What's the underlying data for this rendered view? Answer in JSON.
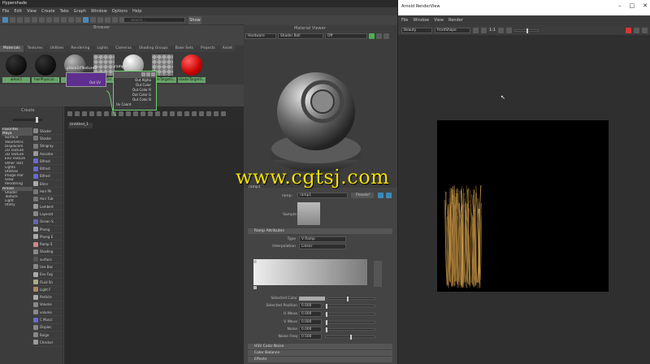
{
  "hypershade": {
    "title": "Hypershade",
    "menu": [
      "File",
      "Edit",
      "View",
      "Create",
      "Tabs",
      "Graph",
      "Window",
      "Options",
      "Help"
    ],
    "browser_label": "Browser",
    "search_placeholder": "Search...",
    "show_label": "Show",
    "tabs": [
      "Materials",
      "Textures",
      "Utilities",
      "Rendering",
      "Lights",
      "Cameras",
      "Shading Groups",
      "Bake Sets",
      "Projects",
      "Asset"
    ],
    "swatches": [
      {
        "label": "aiHair1",
        "color": "#111111",
        "type": "dark"
      },
      {
        "label": "hairPhysical...",
        "color": "#151515",
        "type": "dark"
      },
      {
        "label": "lambert1",
        "color": "#7a7a7a",
        "type": "grey"
      },
      {
        "label": "particleClo...",
        "color": "#aaaaaa",
        "type": "checker"
      },
      {
        "label": "shaderGlow1",
        "color": "#999999",
        "type": "white",
        "selected": true
      },
      {
        "label": "shaderTargetG...",
        "color": "#999999",
        "type": "checker"
      },
      {
        "label": "shaderTargetG...",
        "color": "#cc0000",
        "type": "red"
      }
    ],
    "create_label": "Create",
    "categories": [
      {
        "label": "Favorites",
        "hdr": true
      },
      {
        "label": "Maya",
        "hdr": true
      },
      {
        "label": "Surface"
      },
      {
        "label": "Volumetric"
      },
      {
        "label": "Displacem"
      },
      {
        "label": "2D Texture"
      },
      {
        "label": "3D Texture"
      },
      {
        "label": "Env Texture"
      },
      {
        "label": "Other Text"
      },
      {
        "label": "Lights"
      },
      {
        "label": "Utilities"
      },
      {
        "label": "Image Plar"
      },
      {
        "label": "Glow"
      },
      {
        "label": "Rendering"
      },
      {
        "label": "Arnold",
        "hdr": true
      },
      {
        "label": "Shader"
      },
      {
        "label": "Texture"
      },
      {
        "label": "Light"
      },
      {
        "label": "Utility"
      }
    ],
    "nodes": [
      "Shader",
      "Shader",
      "Stingray",
      "Anisotro",
      "Bifrost",
      "Bifrost",
      "Bifrost",
      "Blinn",
      "Hair Ph",
      "Hair Tub",
      "Lambert",
      "Layered",
      "Ocean S",
      "Phong",
      "Phong E",
      "Ramp S",
      "Shading",
      "surface",
      "Use Bac",
      "Env Fog",
      "Fluid Sh",
      "Light F",
      "Particle",
      "Volume",
      "volume",
      "C Muscl",
      "Displac",
      "Bulge",
      "Checker"
    ],
    "graph_tab": "Untitled_1",
    "node_place": {
      "title": "place2dTexture2",
      "port": "Out UV"
    },
    "node_ramp": {
      "title": "ramp1",
      "ports": [
        "Out Alpha",
        "Out Color",
        "Out Color R",
        "Out Color G",
        "Out Color B"
      ],
      "in_port": "Uv Coord"
    }
  },
  "material_viewer": {
    "label": "Material Viewer",
    "renderer": "Hardware",
    "shape": "Shader Ball",
    "env": "Off"
  },
  "attr_editor": {
    "node_name": "ramp1",
    "ramp_label": "ramp:",
    "ramp_value": "ramp1",
    "presets": "Presets*",
    "sample_label": "Sample",
    "section_ramp": "Ramp Attributes",
    "type_label": "Type",
    "type_value": "V Ramp",
    "interp_label": "Interpolation",
    "interp_value": "Linear",
    "sel_color_label": "Selected Color",
    "sel_pos_label": "Selected Position",
    "sel_pos_value": "0.000",
    "uwave_label": "U Wave",
    "uwave_value": "0.000",
    "vwave_label": "V Wave",
    "vwave_value": "0.000",
    "noise_label": "Noise",
    "noise_value": "0.000",
    "noisefreq_label": "Noise Freq",
    "noisefreq_value": "0.500",
    "sections": [
      "HSV Color Noise",
      "Color Balance",
      "Effects"
    ]
  },
  "arnold": {
    "title": "Arnold RenderView",
    "menu": [
      "File",
      "Window",
      "View",
      "Render"
    ],
    "status": "Beauty",
    "camera": "frontShape",
    "ratio": "1:1"
  },
  "watermark": "www.cgtsj.com"
}
